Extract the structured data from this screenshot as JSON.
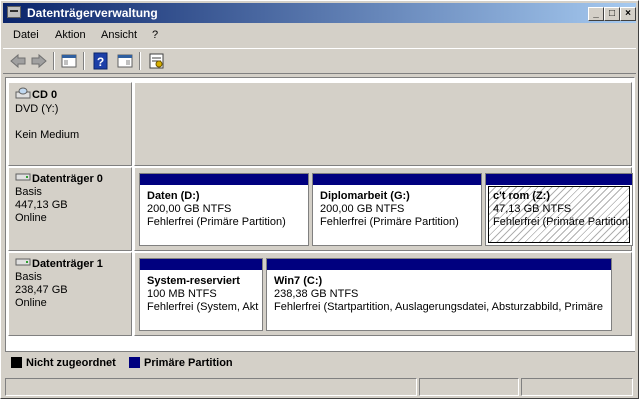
{
  "window": {
    "title": "Datenträgerverwaltung"
  },
  "menu": {
    "items": [
      {
        "label": "Datei"
      },
      {
        "label": "Aktion"
      },
      {
        "label": "Ansicht"
      },
      {
        "label": "?"
      }
    ]
  },
  "toolbar": {
    "buttons": [
      "back-arrow-icon",
      "forward-arrow-icon",
      "console-tree-icon",
      "help-icon",
      "action-pane-icon",
      "properties-icon"
    ]
  },
  "disks": [
    {
      "name": "CD 0",
      "line1": "DVD (Y:)",
      "line2": "",
      "line3": "Kein Medium",
      "partitions": []
    },
    {
      "name": "Datenträger 0",
      "line1": "Basis",
      "line2": "447,13 GB",
      "line3": "Online",
      "partitions": [
        {
          "name": "Daten  (D:)",
          "size": "200,00 GB NTFS",
          "status": "Fehlerfrei (Primäre Partition)"
        },
        {
          "name": "Diplomarbeit  (G:)",
          "size": "200,00 GB NTFS",
          "status": "Fehlerfrei (Primäre Partition)"
        },
        {
          "name": "c't rom  (Z:)",
          "size": "47,13 GB NTFS",
          "status": "Fehlerfrei (Primäre Partition)"
        }
      ]
    },
    {
      "name": "Datenträger 1",
      "line1": "Basis",
      "line2": "238,47 GB",
      "line3": "Online",
      "partitions": [
        {
          "name": "System-reserviert",
          "size": "100 MB NTFS",
          "status": "Fehlerfrei (System, Akti"
        },
        {
          "name": "Win7  (C:)",
          "size": "238,38 GB NTFS",
          "status": "Fehlerfrei (Startpartition, Auslagerungsdatei, Absturzabbild, Primäre"
        }
      ]
    }
  ],
  "legend": {
    "unallocated": "Nicht zugeordnet",
    "primary": "Primäre Partition",
    "unallocated_color": "#000000",
    "primary_color": "#00007f"
  }
}
